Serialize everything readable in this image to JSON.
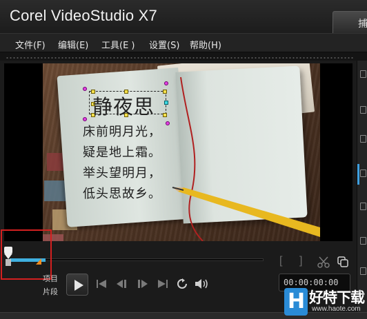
{
  "window": {
    "title": "Corel VideoStudio X7",
    "capture_tab": "捕"
  },
  "menu": [
    {
      "label": "文件(F)"
    },
    {
      "label": "编辑(E)"
    },
    {
      "label": "工具(E )"
    },
    {
      "label": "设置(S)"
    },
    {
      "label": "帮助(H)"
    }
  ],
  "preview": {
    "poem_title": "静夜思",
    "poem_lines": [
      "床前明月光，",
      "疑是地上霜。",
      "举头望明月，",
      "低头思故乡。"
    ]
  },
  "playback": {
    "mode_project": "项目",
    "mode_clip": "片段",
    "timecode": "00:00:00:00",
    "trim_progress_percent": 14
  },
  "watermark": {
    "logo": "H",
    "name": "好特下载",
    "url": "www.haote.com"
  },
  "colors": {
    "accent": "#3fb0e0",
    "mark_out": "#f08a1e",
    "highlight": "#d42020"
  }
}
